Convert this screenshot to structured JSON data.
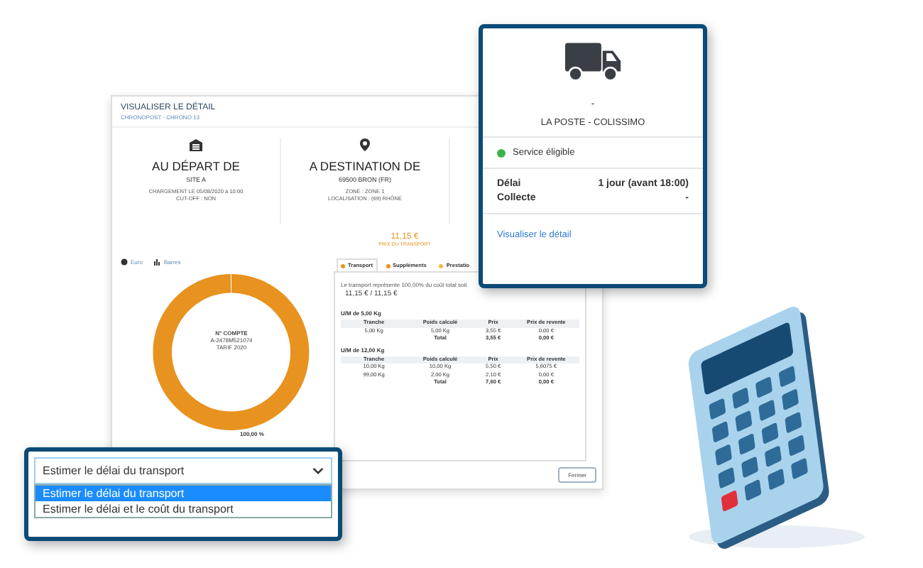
{
  "detail": {
    "title": "VISUALISER LE DÉTAIL",
    "subtitle": "CHRONOPOST - CHRONO 13",
    "origin": {
      "heading": "AU DÉPART DE",
      "place": "SITE A",
      "lines": [
        "CHARGEMENT LE 05/08/2020 à 10:00",
        "CUT-OFF : NON"
      ]
    },
    "destination": {
      "heading": "A DESTINATION DE",
      "place": "69500 BRON (FR)",
      "lines": [
        "ZONE : ZONE 1",
        "LOCALISATION : (69) RHÔNE"
      ]
    },
    "price": "11,15 €",
    "price_label": "PRIX DU TRANSPORT",
    "legend": [
      "Euro",
      "Barres"
    ],
    "donut": {
      "lines": [
        "N° COMPTE",
        "A-2478M521074",
        "TARIF 2020"
      ],
      "percent_label": "100,00 %"
    },
    "tabs": [
      {
        "label": "Transport",
        "color": "#e8921f",
        "selected": true
      },
      {
        "label": "Suppléments",
        "color": "#e8921f",
        "selected": false
      },
      {
        "label": "Prestatio",
        "color": "#f2b84b",
        "selected": false
      }
    ],
    "summary": "Le transport représente 100,00% du coût total soit",
    "summary_value": "11,15 € / 11,15 €",
    "groups": [
      {
        "title": "U/M de 5,00 Kg",
        "columns": [
          "Tranche",
          "Poids calculé",
          "Prix",
          "Prix de revente"
        ],
        "rows": [
          [
            "5,00 Kg",
            "5,00 Kg",
            "3,55 €",
            "0,00 €"
          ]
        ],
        "total": [
          "Total",
          "3,55 €",
          "0,00 €"
        ]
      },
      {
        "title": "U/M de 12,00 Kg",
        "columns": [
          "Tranche",
          "Poids calculé",
          "Prix",
          "Prix de revente"
        ],
        "rows": [
          [
            "10,00 Kg",
            "10,00 Kg",
            "5,50 €",
            "5,6075 €"
          ],
          [
            "99,00 Kg",
            "2,00 Kg",
            "2,10 €",
            "0,00 €"
          ]
        ],
        "total": [
          "Total",
          "7,60 €",
          "0,00 €"
        ]
      }
    ],
    "close_button": "Fermer"
  },
  "card": {
    "dash": "-",
    "carrier": "LA POSTE - COLISSIMO",
    "status": "Service éligible",
    "rows": [
      {
        "label": "Délai",
        "value": "1 jour (avant 18:00)"
      },
      {
        "label": "Collecte",
        "value": "-"
      }
    ],
    "link": "Visualiser le détail"
  },
  "dropdown": {
    "value": "Estimer le délai du transport",
    "options": [
      {
        "label": "Estimer le délai du transport",
        "selected": true
      },
      {
        "label": "Estimer le délai et le coût du transport",
        "selected": false
      }
    ]
  }
}
